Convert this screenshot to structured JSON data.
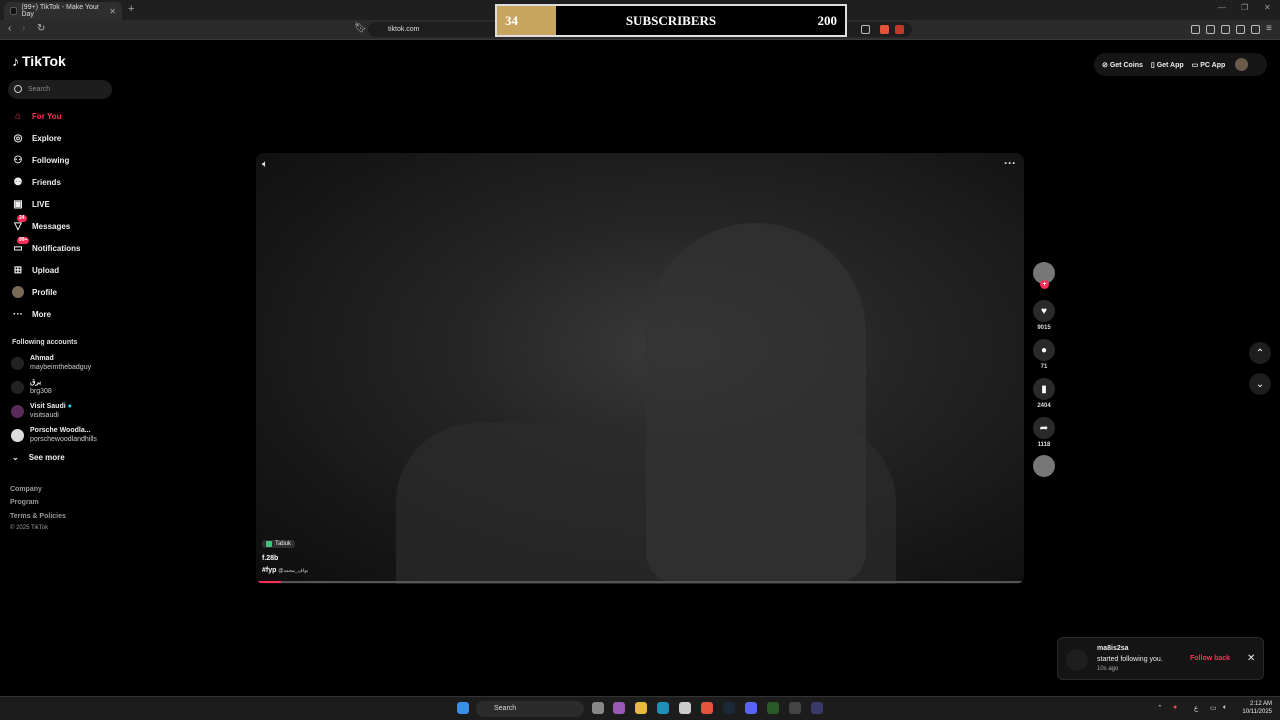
{
  "browser": {
    "tab_title": "(99+) TikTok - Make Your Day",
    "url": "tiktok.com",
    "new_tab": "+"
  },
  "subscribers_overlay": {
    "current": "34",
    "label": "SUBSCRIBERS",
    "goal": "200",
    "progress_fraction": 0.17
  },
  "sidebar": {
    "logo": "TikTok",
    "search_placeholder": "Search",
    "nav": [
      {
        "label": "For You",
        "icon": "home-icon",
        "active": true
      },
      {
        "label": "Explore",
        "icon": "compass-icon"
      },
      {
        "label": "Following",
        "icon": "following-icon"
      },
      {
        "label": "Friends",
        "icon": "friends-icon"
      },
      {
        "label": "LIVE",
        "icon": "live-icon"
      },
      {
        "label": "Messages",
        "icon": "messages-icon",
        "badge": "24"
      },
      {
        "label": "Notifications",
        "icon": "notifications-icon",
        "badge": "99+"
      },
      {
        "label": "Upload",
        "icon": "upload-icon"
      },
      {
        "label": "Profile",
        "icon": "profile-avatar"
      },
      {
        "label": "More",
        "icon": "more-icon"
      }
    ],
    "following_title": "Following accounts",
    "accounts": [
      {
        "name": "Ahmad",
        "handle": "maybeimthebadguy"
      },
      {
        "name": "برق",
        "handle": "brg308"
      },
      {
        "name": "Visit Saudi",
        "handle": "visitsaudi",
        "verified": true
      },
      {
        "name": "Porsche Woodla...",
        "handle": "porschewoodlandhills"
      }
    ],
    "see_more": "See more",
    "footer": [
      "Company",
      "Program",
      "Terms & Policies",
      "© 2025 TikTok"
    ]
  },
  "top_right": {
    "get_coins": "Get Coins",
    "get_app": "Get App",
    "pc_app": "PC App"
  },
  "video": {
    "location": "Tabuk",
    "caption": "f.28b",
    "hashtag": "#fyp",
    "mention": "@نواف_محمد",
    "progress_fraction": 0.03
  },
  "actions": {
    "likes": "9015",
    "comments": "71",
    "saves": "2404",
    "shares": "1118"
  },
  "toast": {
    "user": "ma8is2sa",
    "message": "started following you.",
    "time": "10s ago",
    "action": "Follow back"
  },
  "taskbar": {
    "search": "Search",
    "time": "2:12 AM",
    "date": "10/11/2025",
    "lang": "ع"
  },
  "colors": {
    "accent": "#fe2c55",
    "overlay_fill": "#c7a55e"
  }
}
